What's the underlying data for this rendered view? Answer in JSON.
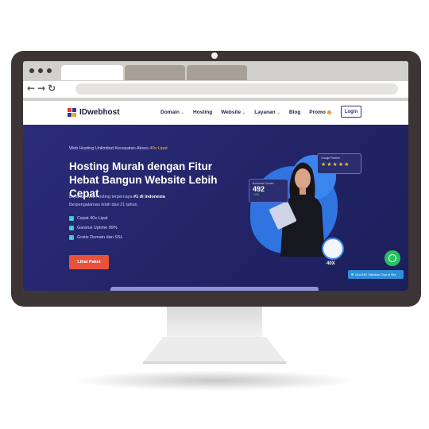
{
  "site": {
    "logo_text": "IDwebhost",
    "menu": [
      {
        "label": "Domain",
        "chevron": true
      },
      {
        "label": "Hosting",
        "chevron": false
      },
      {
        "label": "Website",
        "chevron": true
      },
      {
        "label": "Layanan",
        "chevron": true
      },
      {
        "label": "Blog",
        "chevron": false
      },
      {
        "label": "Promo",
        "chevron": false
      }
    ],
    "login_label": "Login"
  },
  "hero": {
    "subtitle_prefix": "Web Hosting Unlimited Kecepatan Akses",
    "subtitle_highlight": "40x Lipat",
    "title": "Hosting Murah dengan Fitur Hebat Bangun Website Lebih Cepat",
    "desc_prefix": "Layanan web hosting terpercaya",
    "desc_bold": "#1 di Indonesia",
    "desc_suffix": "Berpengalaman lebih dari 21 tahun.",
    "features": [
      "Cepat 40x Lipat",
      "Garansi Uptime 99%",
      "Gratis Domain dan SSL"
    ],
    "cta_label": "Lihat Paket"
  },
  "illustration": {
    "growth_label": "Business Growth",
    "growth_value": "492",
    "growth_delta": "+ 8%",
    "review_label": "Google Review",
    "review_stars": 5,
    "speed_label": "40X"
  },
  "widgets": {
    "chat_label": "ONLINE! Silahkan Chat di Sini"
  },
  "colors": {
    "hero_bg": "#24256a",
    "accent_orange": "#f7b64a",
    "cta": "#e8523c",
    "whatsapp": "#25c15f",
    "monitor_bezel": "#3d3535"
  }
}
